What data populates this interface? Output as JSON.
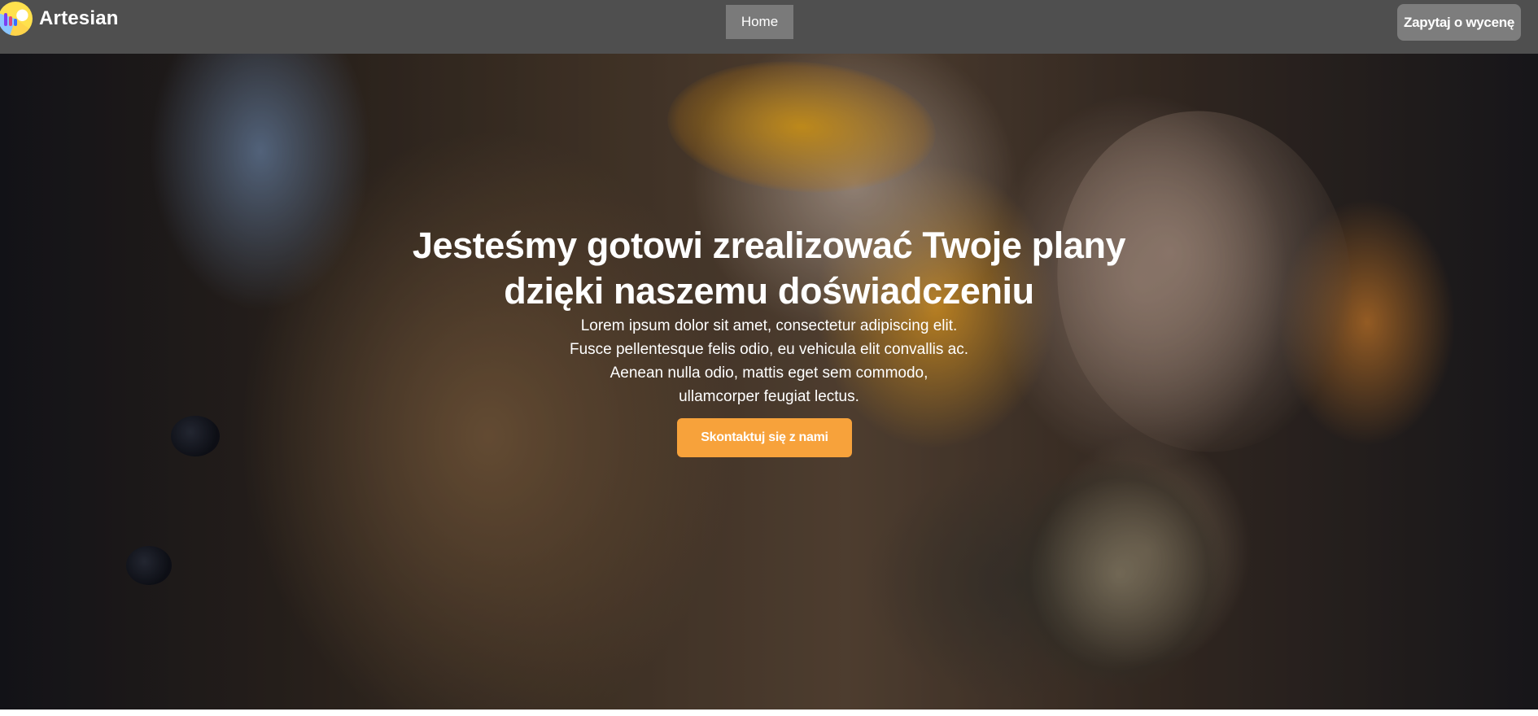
{
  "header": {
    "brand": "Artesian",
    "nav": [
      {
        "label": "Home"
      }
    ],
    "quote_button": "Zapytaj o wycenę"
  },
  "hero": {
    "title": "Jesteśmy gotowi zrealizować Twoje plany dzięki naszemu doświadczeniu",
    "subtitle_lines": [
      "Lorem ipsum dolor sit amet, consectetur adipiscing elit.",
      "Fusce pellentesque felis odio, eu vehicula elit convallis ac.",
      "Aenean nulla odio, mattis eget sem commodo,",
      "ullamcorper feugiat lectus."
    ],
    "cta_label": "Skontaktuj się z nami"
  },
  "colors": {
    "nav_bg": "#4f4f4f",
    "nav_active": "#7a7a7a",
    "quote_button_bg": "#7d7d7d",
    "cta_bg": "#f7a23b",
    "text": "#ffffff"
  },
  "icons": {
    "logo": "artesian-logo-icon"
  }
}
